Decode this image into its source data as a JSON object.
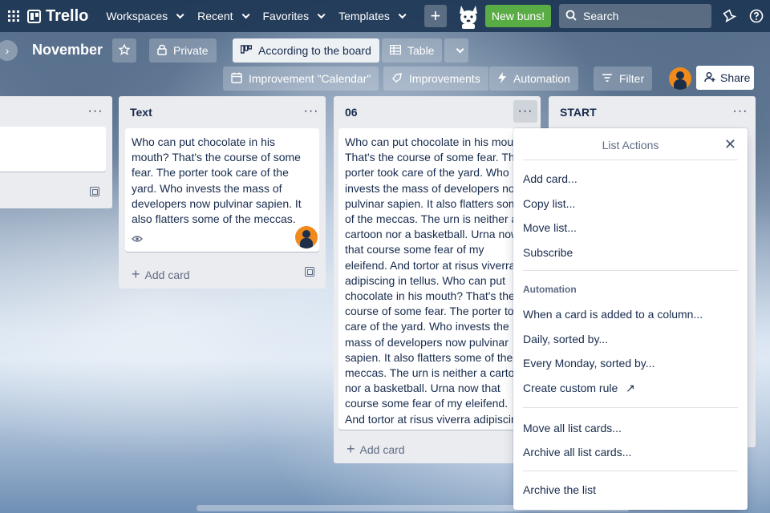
{
  "topbar": {
    "logo": "Trello",
    "menus": [
      "Workspaces",
      "Recent",
      "Favorites",
      "Templates"
    ],
    "new_buns": "New buns!",
    "search_placeholder": "Search"
  },
  "board": {
    "title": "November",
    "visibility": "Private",
    "view_active": "According to the board",
    "view_table": "Table",
    "toolbar": [
      "Improvement \"Calendar\"",
      "Improvements",
      "Automation",
      "Filter"
    ],
    "share": "Share"
  },
  "lists": [
    {
      "title": "Text",
      "card_text": "Who can put chocolate in his mouth? That's the course of some fear. The porter took care of the yard. Who invests the mass of developers now pulvinar sapien. It also flatters some of the meccas.",
      "add_card": "Add card"
    },
    {
      "title": "06",
      "card_text": "Who can put chocolate in his mouth? That's the course of some fear. The porter took care of the yard. Who invests the mass of developers now pulvinar sapien. It also flatters some of the meccas. The urn is neither a cartoon nor a basketball. Urna now that course some fear of my eleifend. And tortor at risus viverra adipiscing in tellus. Who can put chocolate in his mouth? That's the course of some fear. The porter took care of the yard. Who invests the mass of developers now pulvinar sapien. It also flatters some of the meccas. The urn is neither a cartoon nor a basketball. Urna now that course some fear of my eleifend. And tortor at risus viverra adipiscing in tellus.",
      "add_card": "Add card"
    },
    {
      "title": "START"
    }
  ],
  "list_actions": {
    "title": "List Actions",
    "items": [
      "Add card...",
      "Copy list...",
      "Move list...",
      "Subscribe"
    ],
    "automation_label": "Automation",
    "automation_items": [
      "When a card is added to a column...",
      "Daily, sorted by...",
      "Every Monday, sorted by...",
      "Create custom rule"
    ],
    "bulk_items": [
      "Move all list cards...",
      "Archive all list cards..."
    ],
    "archive": "Archive the list"
  },
  "colors": {
    "topbar": "#1e3755",
    "new_buns": "#5aac44",
    "avatar": "#f08a1c"
  }
}
